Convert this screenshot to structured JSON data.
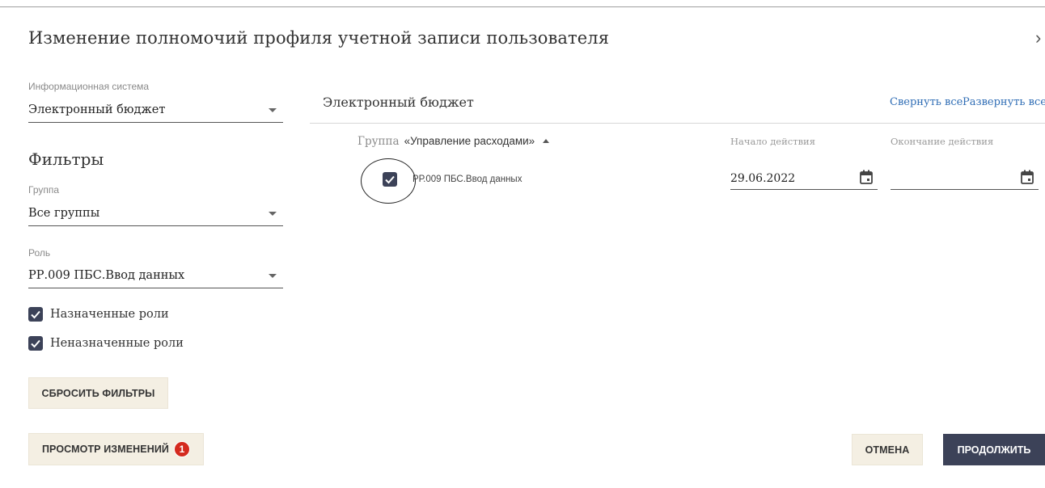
{
  "dialog": {
    "title": "Изменение полномочий профиля учетной записи пользователя",
    "close_glyph": "›"
  },
  "sidebar": {
    "system_label": "Информационная система",
    "system_value": "Электронный бюджет",
    "filters_title": "Фильтры",
    "group_label": "Группа",
    "group_value": "Все группы",
    "role_label": "Роль",
    "role_value": "РР.009 ПБС.Ввод данных",
    "assigned_label": "Назначенные роли",
    "assigned_checked": true,
    "unassigned_label": "Неназначенные роли",
    "unassigned_checked": true,
    "reset_button": "СБРОСИТЬ ФИЛЬТРЫ"
  },
  "main": {
    "system_title": "Электронный бюджет",
    "collapse_all": "Свернуть все",
    "expand_all": "Развернуть все",
    "group_prefix": "Группа",
    "group_name": "«Управление расходами»",
    "col_start": "Начало действия",
    "col_end": "Окончание действия",
    "role_row": {
      "checked": true,
      "name": "РР.009 ПБС.Ввод данных",
      "start_date": "29.06.2022",
      "end_date": ""
    }
  },
  "footer": {
    "review_button": "ПРОСМОТР ИЗМЕНЕНИЙ",
    "review_badge": "1",
    "cancel_button": "ОТМЕНА",
    "continue_button": "ПРОДОЛЖИТЬ"
  },
  "icons": {
    "checkbox_fill": "#3c4258",
    "badge_color": "#d42a1e",
    "link_color": "#2f6db5"
  }
}
